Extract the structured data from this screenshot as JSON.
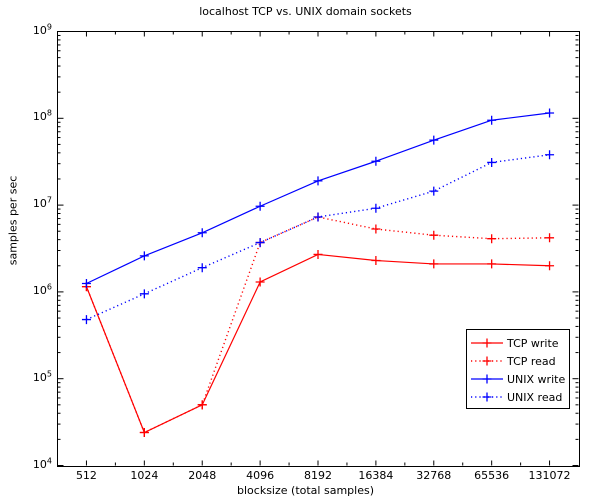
{
  "chart_data": {
    "type": "line",
    "title": "localhost TCP vs. UNIX domain sockets",
    "xlabel": "blocksize (total samples)",
    "ylabel": "samples per sec",
    "xscale": "log2",
    "yscale": "log10",
    "grid": false,
    "legend_position": "lower right",
    "categories": [
      512,
      1024,
      2048,
      4096,
      8192,
      16384,
      32768,
      65536,
      131072
    ],
    "xtick_labels": [
      "512",
      "1024",
      "2048",
      "4096",
      "8192",
      "16384",
      "32768",
      "65536",
      "131072"
    ],
    "ytick_labels": [
      "10^4",
      "10^5",
      "10^6",
      "10^7",
      "10^8",
      "10^9"
    ],
    "ytick_mantissas": [
      "10",
      "10",
      "10",
      "10",
      "10",
      "10"
    ],
    "ytick_exponents": [
      "4",
      "5",
      "6",
      "7",
      "8",
      "9"
    ],
    "ylim": [
      10000,
      1000000000
    ],
    "xlim": [
      362,
      185363
    ],
    "series": [
      {
        "name": "TCP write",
        "color": "#ff0000",
        "style": "solid",
        "marker": "plus",
        "values": [
          1150000,
          24000,
          50000,
          1300000,
          2700000,
          2300000,
          2100000,
          2100000,
          2000000
        ]
      },
      {
        "name": "TCP read",
        "color": "#ff0000",
        "style": "dotted",
        "marker": "plus",
        "values": [
          1150000,
          24000,
          50000,
          3700000,
          7300000,
          5300000,
          4500000,
          4100000,
          4200000
        ]
      },
      {
        "name": "UNIX write",
        "color": "#0000ff",
        "style": "solid",
        "marker": "plus",
        "values": [
          1250000,
          2600000,
          4800000,
          9700000,
          19000000,
          32000000,
          56000000,
          95000000,
          115000000
        ]
      },
      {
        "name": "UNIX read",
        "color": "#0000ff",
        "style": "dotted",
        "marker": "plus",
        "values": [
          480000,
          950000,
          1900000,
          3700000,
          7300000,
          9200000,
          14500000,
          31000000,
          38000000
        ]
      }
    ]
  },
  "legend": {
    "items": [
      {
        "label": "TCP write"
      },
      {
        "label": "TCP read"
      },
      {
        "label": "UNIX write"
      },
      {
        "label": "UNIX read"
      }
    ]
  }
}
